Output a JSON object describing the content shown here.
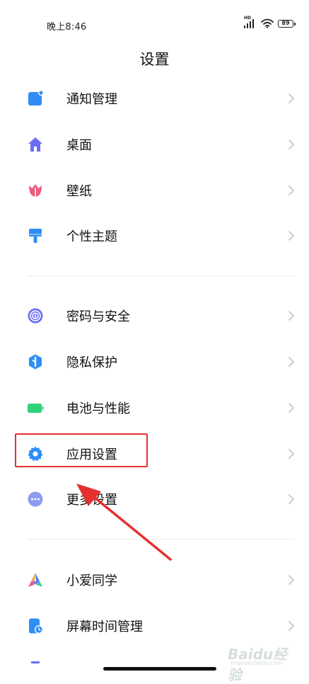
{
  "status_bar": {
    "time": "晚上8:46",
    "network_label": "HD",
    "battery_level": "89"
  },
  "page": {
    "title": "设置"
  },
  "groups": [
    {
      "items": [
        {
          "label": "通知管理",
          "icon": "notification-icon",
          "color": "#2f8df5"
        },
        {
          "label": "桌面",
          "icon": "home-icon",
          "color": "#6b6cf6"
        },
        {
          "label": "壁纸",
          "icon": "tulip-icon",
          "color": "#f05a7d"
        },
        {
          "label": "个性主题",
          "icon": "paint-brush-icon",
          "color": "#2f8df5"
        }
      ]
    },
    {
      "items": [
        {
          "label": "密码与安全",
          "icon": "fingerprint-icon",
          "color": "#6b6cf6"
        },
        {
          "label": "隐私保护",
          "icon": "privacy-shield-icon",
          "color": "#2f8df5"
        },
        {
          "label": "电池与性能",
          "icon": "battery-icon",
          "color": "#2fd27a"
        },
        {
          "label": "应用设置",
          "icon": "gear-icon",
          "color": "#2f8df5"
        },
        {
          "label": "更多设置",
          "icon": "more-dots-icon",
          "color": "#8c9cf0"
        }
      ]
    },
    {
      "items": [
        {
          "label": "小爱同学",
          "icon": "xiaoai-icon",
          "color": "#4a7cf7"
        },
        {
          "label": "屏幕时间管理",
          "icon": "screen-time-icon",
          "color": "#2f8df5"
        }
      ]
    }
  ],
  "annotation": {
    "highlighted_item": "应用设置",
    "color": "#e63030"
  },
  "watermark": {
    "text": "Baidu经验",
    "sub": "jingyan.baidu.com"
  }
}
